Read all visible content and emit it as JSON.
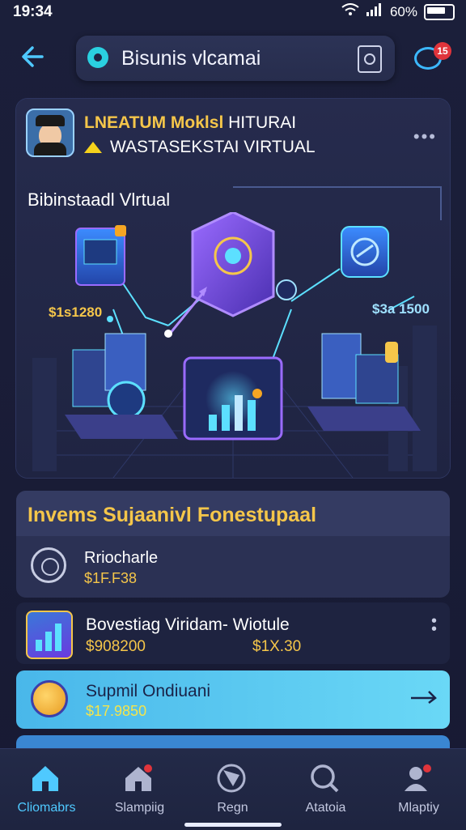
{
  "status_bar": {
    "time": "19:34",
    "battery": "60%"
  },
  "header": {
    "search_text": "Bisunis vlcamai",
    "chat_badge": "15"
  },
  "hero": {
    "title_yellow": "LNEATUM Moklsl",
    "title_white": "HITURAI",
    "subtitle": "WASTASEKSTAI VIRTUAL",
    "illustration_label": "Bibinstaadl Vlrtual",
    "price_left": "$1s1280",
    "price_right": "$3a 1500"
  },
  "section": {
    "title": "Invems Sujaanivl Fonestupaal",
    "item_name": "Rriocharle",
    "item_value": "$1F.F38"
  },
  "list": [
    {
      "name": "Bovestiag Viridam- Wiotule",
      "value1": "$908200",
      "value2": "$1X.30"
    },
    {
      "name": "Supmil Ondiuani",
      "value1": "$17.9850"
    }
  ],
  "tabs": [
    {
      "label": "Cliomabrs",
      "icon": "home-icon"
    },
    {
      "label": "Slampiig",
      "icon": "store-icon"
    },
    {
      "label": "Regn",
      "icon": "compass-icon"
    },
    {
      "label": "Atatoia",
      "icon": "search-icon"
    },
    {
      "label": "Mlaptiy",
      "icon": "profile-icon"
    }
  ],
  "colors": {
    "accent": "#4fc9ff",
    "gold": "#f5c64a",
    "highlight": "#6ad8f6",
    "badge": "#e0343b"
  }
}
